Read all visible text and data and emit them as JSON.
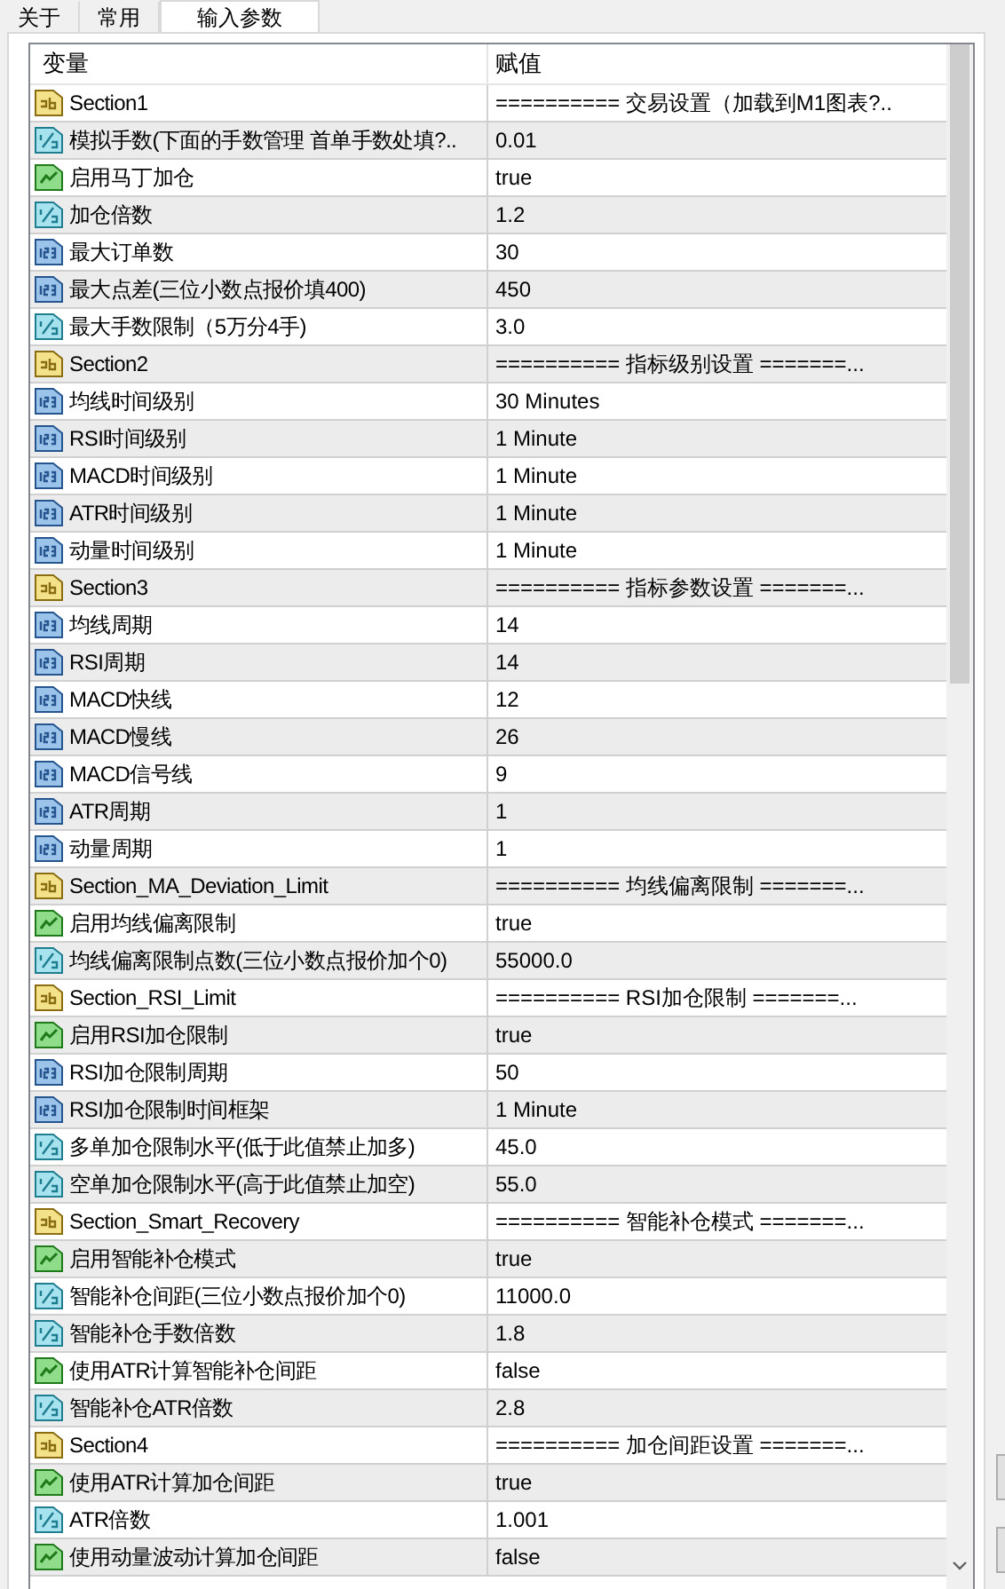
{
  "tabs": [
    {
      "label": "关于",
      "selected": false
    },
    {
      "label": "常用",
      "selected": false
    },
    {
      "label": "输入参数",
      "selected": true
    }
  ],
  "table": {
    "columns": [
      "变量",
      "赋值"
    ],
    "rows": [
      {
        "kind": "string",
        "name": "Section1",
        "value": "========== 交易设置（加载到M1图表?.."
      },
      {
        "kind": "double",
        "name": "模拟手数(下面的手数管理 首单手数处填?..",
        "value": "0.01"
      },
      {
        "kind": "bool",
        "name": "启用马丁加仓",
        "value": "true"
      },
      {
        "kind": "double",
        "name": "加仓倍数",
        "value": "1.2"
      },
      {
        "kind": "int",
        "name": "最大订单数",
        "value": "30"
      },
      {
        "kind": "int",
        "name": "最大点差(三位小数点报价填400)",
        "value": "450"
      },
      {
        "kind": "double",
        "name": "最大手数限制（5万分4手)",
        "value": "3.0"
      },
      {
        "kind": "string",
        "name": "Section2",
        "value": "========== 指标级别设置 =======..."
      },
      {
        "kind": "int",
        "name": "均线时间级别",
        "value": "30 Minutes"
      },
      {
        "kind": "int",
        "name": "RSI时间级别",
        "value": "1 Minute"
      },
      {
        "kind": "int",
        "name": "MACD时间级别",
        "value": "1 Minute"
      },
      {
        "kind": "int",
        "name": "ATR时间级别",
        "value": "1 Minute"
      },
      {
        "kind": "int",
        "name": "动量时间级别",
        "value": "1 Minute"
      },
      {
        "kind": "string",
        "name": "Section3",
        "value": "========== 指标参数设置 =======..."
      },
      {
        "kind": "int",
        "name": "均线周期",
        "value": "14"
      },
      {
        "kind": "int",
        "name": "RSI周期",
        "value": "14"
      },
      {
        "kind": "int",
        "name": "MACD快线",
        "value": "12"
      },
      {
        "kind": "int",
        "name": "MACD慢线",
        "value": "26"
      },
      {
        "kind": "int",
        "name": "MACD信号线",
        "value": "9"
      },
      {
        "kind": "int",
        "name": "ATR周期",
        "value": "1"
      },
      {
        "kind": "int",
        "name": "动量周期",
        "value": "1"
      },
      {
        "kind": "string",
        "name": "Section_MA_Deviation_Limit",
        "value": "========== 均线偏离限制 =======..."
      },
      {
        "kind": "bool",
        "name": "启用均线偏离限制",
        "value": "true"
      },
      {
        "kind": "double",
        "name": "均线偏离限制点数(三位小数点报价加个0)",
        "value": "55000.0"
      },
      {
        "kind": "string",
        "name": "Section_RSI_Limit",
        "value": "========== RSI加仓限制 =======..."
      },
      {
        "kind": "bool",
        "name": "启用RSI加仓限制",
        "value": "true"
      },
      {
        "kind": "int",
        "name": "RSI加仓限制周期",
        "value": "50"
      },
      {
        "kind": "int",
        "name": "RSI加仓限制时间框架",
        "value": "1 Minute"
      },
      {
        "kind": "double",
        "name": "多单加仓限制水平(低于此值禁止加多)",
        "value": "45.0"
      },
      {
        "kind": "double",
        "name": "空单加仓限制水平(高于此值禁止加空)",
        "value": "55.0"
      },
      {
        "kind": "string",
        "name": "Section_Smart_Recovery",
        "value": "========== 智能补仓模式 =======..."
      },
      {
        "kind": "bool",
        "name": "启用智能补仓模式",
        "value": "true"
      },
      {
        "kind": "double",
        "name": "智能补仓间距(三位小数点报价加个0)",
        "value": "11000.0"
      },
      {
        "kind": "double",
        "name": "智能补仓手数倍数",
        "value": "1.8"
      },
      {
        "kind": "bool",
        "name": "使用ATR计算智能补仓间距",
        "value": "false"
      },
      {
        "kind": "double",
        "name": "智能补仓ATR倍数",
        "value": "2.8"
      },
      {
        "kind": "string",
        "name": "Section4",
        "value": "========== 加仓间距设置 =======..."
      },
      {
        "kind": "bool",
        "name": "使用ATR计算加仓间距",
        "value": "true"
      },
      {
        "kind": "double",
        "name": "ATR倍数",
        "value": "1.001"
      },
      {
        "kind": "bool",
        "name": "使用动量波动计算加仓间距",
        "value": "false"
      }
    ]
  }
}
